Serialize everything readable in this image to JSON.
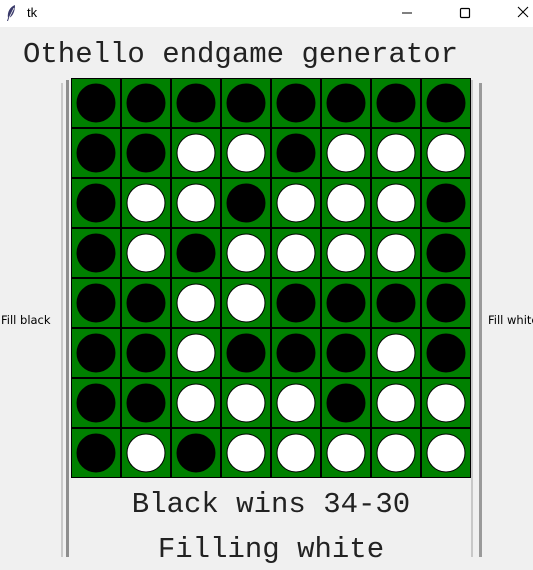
{
  "window": {
    "title": "tk",
    "icon": "feather-icon",
    "controls": [
      "minimize-icon",
      "maximize-icon",
      "close-icon"
    ]
  },
  "header": {
    "title": "Othello endgame generator"
  },
  "left_button": {
    "label": "Fill black"
  },
  "right_button": {
    "label": "Fill white"
  },
  "board": {
    "size": 8,
    "colors": {
      "board": "#008000",
      "black": "#000000",
      "white": "#ffffff",
      "grid": "#000000"
    },
    "rows": [
      "BBBBBBBB",
      "BBWWBWWW",
      "BWWBWWWB",
      "BWBWWWWB",
      "BBWWBBBB",
      "BBWBBBWB",
      "BBWWWBWW",
      "BWBWWWWW"
    ]
  },
  "status": {
    "result": "Black wins 34-30",
    "action": "Filling white"
  }
}
